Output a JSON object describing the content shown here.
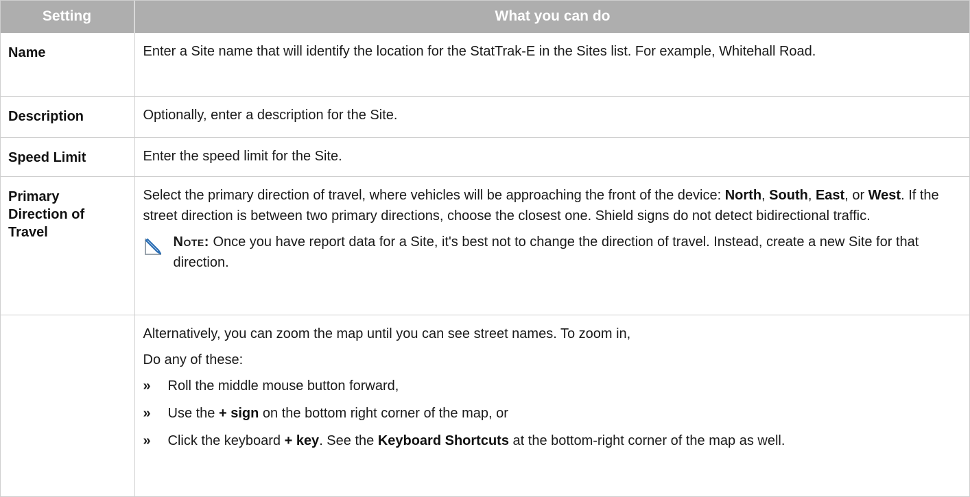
{
  "header": {
    "col_setting": "Setting",
    "col_what": "What you can do"
  },
  "rows": {
    "name": {
      "setting": "Name",
      "text": "Enter a Site name that will identify the location for the StatTrak-E in the Sites list. For example, Whitehall Road."
    },
    "description": {
      "setting": "Description",
      "text": "Optionally, enter a description for the Site."
    },
    "speed": {
      "setting": "Speed Limit",
      "text": "Enter the speed limit for the Site."
    },
    "direction": {
      "setting_line1": "Primary",
      "setting_line2": "Direction of",
      "setting_line3": "Travel",
      "text_a": "Select the primary direction of travel, where vehicles will be approaching the front of the device: ",
      "north": "North",
      "comma1": ", ",
      "south": "South",
      "comma2": ", ",
      "east": "East",
      "or": ", or ",
      "west": "West",
      "text_b": ". If the street direction is between two primary directions, choose the closest one. Shield signs do not detect bidirectional traffic.",
      "note_label": "Note:",
      "note_text": " Once you have report data for a Site, it's best not to change the direction of travel. Instead, create a new Site for that direction.",
      "note_icon": "note-pencil-icon"
    },
    "zoom": {
      "setting": "",
      "intro": "Alternatively, you can zoom the map until you can see street names. To zoom in,",
      "lead": "Do any of these:",
      "bullet_mark": "»",
      "b1": "Roll the middle mouse button forward,",
      "b2_a": "Use the ",
      "b2_bold": "+ sign",
      "b2_b": " on the bottom right corner of the map, or",
      "b3_a": "Click the keyboard ",
      "b3_bold": "+ key",
      "b3_b": ". See the ",
      "b3_bold2": "Keyboard Shortcuts",
      "b3_c": " at the bottom-right corner of the map as well."
    }
  },
  "colors": {
    "header_bg": "#aeaeae",
    "header_text": "#ffffff",
    "note_icon": "#2c6fb5"
  }
}
